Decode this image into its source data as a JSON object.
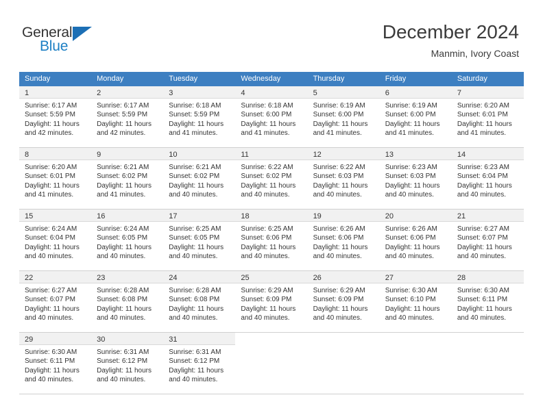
{
  "logo": {
    "general_text": "General",
    "blue_text": "Blue",
    "triangle_color": "#1c6fb5",
    "blue_color": "#1c7fc4"
  },
  "header": {
    "title": "December 2024",
    "subtitle": "Manmin, Ivory Coast"
  },
  "theme": {
    "header_row_color": "#3d7fc1",
    "day_band_color": "#f1f1f1",
    "grid_line_color": "#d0d0d0",
    "text_color": "#333333"
  },
  "weekdays": [
    "Sunday",
    "Monday",
    "Tuesday",
    "Wednesday",
    "Thursday",
    "Friday",
    "Saturday"
  ],
  "weeks": [
    [
      {
        "day": "1",
        "sunrise": "Sunrise: 6:17 AM",
        "sunset": "Sunset: 5:59 PM",
        "daylight_1": "Daylight: 11 hours",
        "daylight_2": "and 42 minutes."
      },
      {
        "day": "2",
        "sunrise": "Sunrise: 6:17 AM",
        "sunset": "Sunset: 5:59 PM",
        "daylight_1": "Daylight: 11 hours",
        "daylight_2": "and 42 minutes."
      },
      {
        "day": "3",
        "sunrise": "Sunrise: 6:18 AM",
        "sunset": "Sunset: 5:59 PM",
        "daylight_1": "Daylight: 11 hours",
        "daylight_2": "and 41 minutes."
      },
      {
        "day": "4",
        "sunrise": "Sunrise: 6:18 AM",
        "sunset": "Sunset: 6:00 PM",
        "daylight_1": "Daylight: 11 hours",
        "daylight_2": "and 41 minutes."
      },
      {
        "day": "5",
        "sunrise": "Sunrise: 6:19 AM",
        "sunset": "Sunset: 6:00 PM",
        "daylight_1": "Daylight: 11 hours",
        "daylight_2": "and 41 minutes."
      },
      {
        "day": "6",
        "sunrise": "Sunrise: 6:19 AM",
        "sunset": "Sunset: 6:00 PM",
        "daylight_1": "Daylight: 11 hours",
        "daylight_2": "and 41 minutes."
      },
      {
        "day": "7",
        "sunrise": "Sunrise: 6:20 AM",
        "sunset": "Sunset: 6:01 PM",
        "daylight_1": "Daylight: 11 hours",
        "daylight_2": "and 41 minutes."
      }
    ],
    [
      {
        "day": "8",
        "sunrise": "Sunrise: 6:20 AM",
        "sunset": "Sunset: 6:01 PM",
        "daylight_1": "Daylight: 11 hours",
        "daylight_2": "and 41 minutes."
      },
      {
        "day": "9",
        "sunrise": "Sunrise: 6:21 AM",
        "sunset": "Sunset: 6:02 PM",
        "daylight_1": "Daylight: 11 hours",
        "daylight_2": "and 41 minutes."
      },
      {
        "day": "10",
        "sunrise": "Sunrise: 6:21 AM",
        "sunset": "Sunset: 6:02 PM",
        "daylight_1": "Daylight: 11 hours",
        "daylight_2": "and 40 minutes."
      },
      {
        "day": "11",
        "sunrise": "Sunrise: 6:22 AM",
        "sunset": "Sunset: 6:02 PM",
        "daylight_1": "Daylight: 11 hours",
        "daylight_2": "and 40 minutes."
      },
      {
        "day": "12",
        "sunrise": "Sunrise: 6:22 AM",
        "sunset": "Sunset: 6:03 PM",
        "daylight_1": "Daylight: 11 hours",
        "daylight_2": "and 40 minutes."
      },
      {
        "day": "13",
        "sunrise": "Sunrise: 6:23 AM",
        "sunset": "Sunset: 6:03 PM",
        "daylight_1": "Daylight: 11 hours",
        "daylight_2": "and 40 minutes."
      },
      {
        "day": "14",
        "sunrise": "Sunrise: 6:23 AM",
        "sunset": "Sunset: 6:04 PM",
        "daylight_1": "Daylight: 11 hours",
        "daylight_2": "and 40 minutes."
      }
    ],
    [
      {
        "day": "15",
        "sunrise": "Sunrise: 6:24 AM",
        "sunset": "Sunset: 6:04 PM",
        "daylight_1": "Daylight: 11 hours",
        "daylight_2": "and 40 minutes."
      },
      {
        "day": "16",
        "sunrise": "Sunrise: 6:24 AM",
        "sunset": "Sunset: 6:05 PM",
        "daylight_1": "Daylight: 11 hours",
        "daylight_2": "and 40 minutes."
      },
      {
        "day": "17",
        "sunrise": "Sunrise: 6:25 AM",
        "sunset": "Sunset: 6:05 PM",
        "daylight_1": "Daylight: 11 hours",
        "daylight_2": "and 40 minutes."
      },
      {
        "day": "18",
        "sunrise": "Sunrise: 6:25 AM",
        "sunset": "Sunset: 6:06 PM",
        "daylight_1": "Daylight: 11 hours",
        "daylight_2": "and 40 minutes."
      },
      {
        "day": "19",
        "sunrise": "Sunrise: 6:26 AM",
        "sunset": "Sunset: 6:06 PM",
        "daylight_1": "Daylight: 11 hours",
        "daylight_2": "and 40 minutes."
      },
      {
        "day": "20",
        "sunrise": "Sunrise: 6:26 AM",
        "sunset": "Sunset: 6:06 PM",
        "daylight_1": "Daylight: 11 hours",
        "daylight_2": "and 40 minutes."
      },
      {
        "day": "21",
        "sunrise": "Sunrise: 6:27 AM",
        "sunset": "Sunset: 6:07 PM",
        "daylight_1": "Daylight: 11 hours",
        "daylight_2": "and 40 minutes."
      }
    ],
    [
      {
        "day": "22",
        "sunrise": "Sunrise: 6:27 AM",
        "sunset": "Sunset: 6:07 PM",
        "daylight_1": "Daylight: 11 hours",
        "daylight_2": "and 40 minutes."
      },
      {
        "day": "23",
        "sunrise": "Sunrise: 6:28 AM",
        "sunset": "Sunset: 6:08 PM",
        "daylight_1": "Daylight: 11 hours",
        "daylight_2": "and 40 minutes."
      },
      {
        "day": "24",
        "sunrise": "Sunrise: 6:28 AM",
        "sunset": "Sunset: 6:08 PM",
        "daylight_1": "Daylight: 11 hours",
        "daylight_2": "and 40 minutes."
      },
      {
        "day": "25",
        "sunrise": "Sunrise: 6:29 AM",
        "sunset": "Sunset: 6:09 PM",
        "daylight_1": "Daylight: 11 hours",
        "daylight_2": "and 40 minutes."
      },
      {
        "day": "26",
        "sunrise": "Sunrise: 6:29 AM",
        "sunset": "Sunset: 6:09 PM",
        "daylight_1": "Daylight: 11 hours",
        "daylight_2": "and 40 minutes."
      },
      {
        "day": "27",
        "sunrise": "Sunrise: 6:30 AM",
        "sunset": "Sunset: 6:10 PM",
        "daylight_1": "Daylight: 11 hours",
        "daylight_2": "and 40 minutes."
      },
      {
        "day": "28",
        "sunrise": "Sunrise: 6:30 AM",
        "sunset": "Sunset: 6:11 PM",
        "daylight_1": "Daylight: 11 hours",
        "daylight_2": "and 40 minutes."
      }
    ],
    [
      {
        "day": "29",
        "sunrise": "Sunrise: 6:30 AM",
        "sunset": "Sunset: 6:11 PM",
        "daylight_1": "Daylight: 11 hours",
        "daylight_2": "and 40 minutes."
      },
      {
        "day": "30",
        "sunrise": "Sunrise: 6:31 AM",
        "sunset": "Sunset: 6:12 PM",
        "daylight_1": "Daylight: 11 hours",
        "daylight_2": "and 40 minutes."
      },
      {
        "day": "31",
        "sunrise": "Sunrise: 6:31 AM",
        "sunset": "Sunset: 6:12 PM",
        "daylight_1": "Daylight: 11 hours",
        "daylight_2": "and 40 minutes."
      },
      {
        "day": "",
        "sunrise": "",
        "sunset": "",
        "daylight_1": "",
        "daylight_2": ""
      },
      {
        "day": "",
        "sunrise": "",
        "sunset": "",
        "daylight_1": "",
        "daylight_2": ""
      },
      {
        "day": "",
        "sunrise": "",
        "sunset": "",
        "daylight_1": "",
        "daylight_2": ""
      },
      {
        "day": "",
        "sunrise": "",
        "sunset": "",
        "daylight_1": "",
        "daylight_2": ""
      }
    ]
  ]
}
